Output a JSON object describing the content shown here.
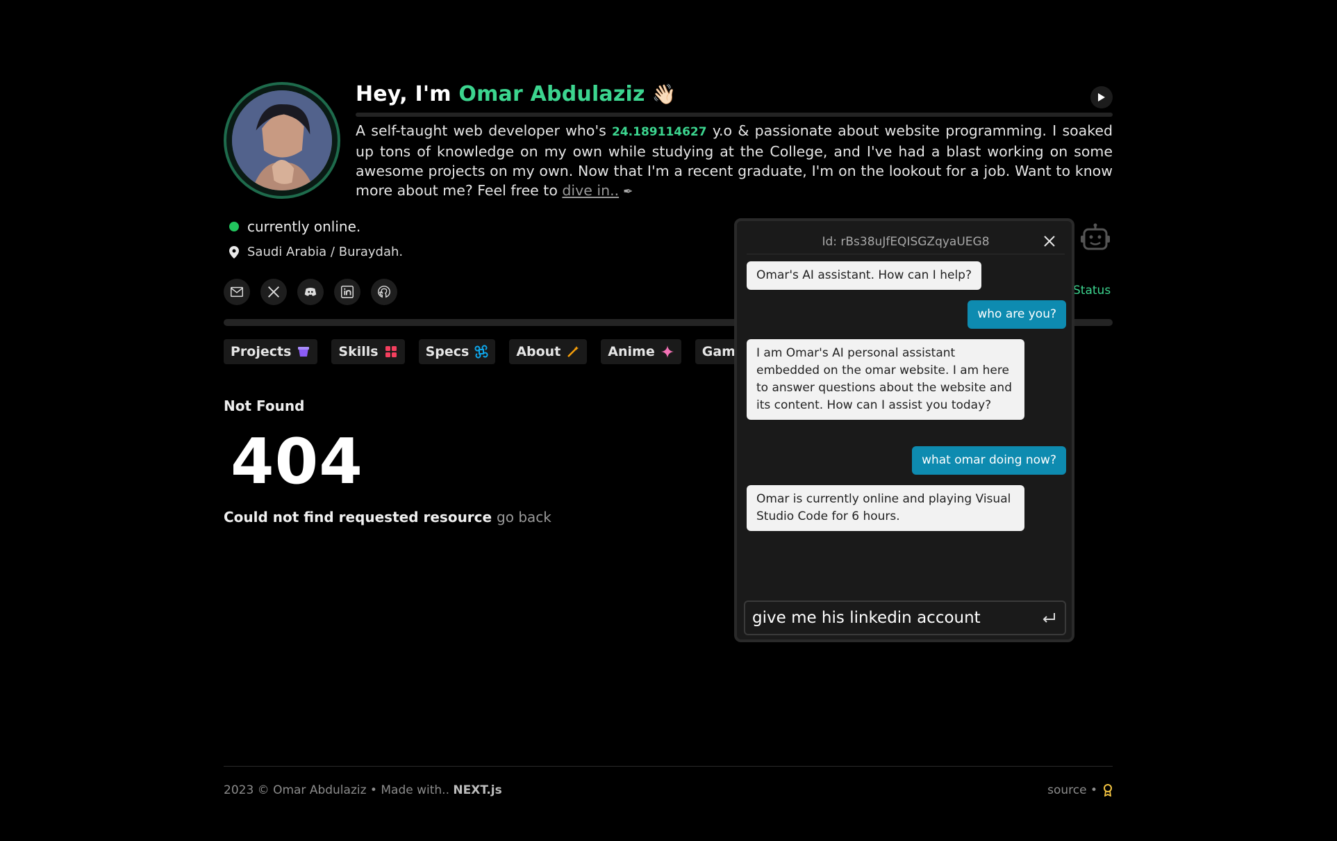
{
  "header": {
    "greeting": "Hey, I'm ",
    "name": "Omar Abdulaziz",
    "wave": "👋🏻"
  },
  "bio": {
    "part1": "A self-taught web developer who's ",
    "age": "24.189114627",
    "part2": " y.o & passionate about website programming. I soaked up tons of knowledge on my own while studying at the College, and I've had a blast working on some awesome projects on my own. Now that I'm a recent graduate, I'm on the lookout for a job. Want to know more about me? Feel free to ",
    "link": "dive in..",
    "pen": "✒"
  },
  "status": {
    "text": "currently online.",
    "location": "Saudi Arabia / Buraydah.",
    "link": "Status"
  },
  "socials": [
    "mail-icon",
    "x-icon",
    "discord-icon",
    "linkedin-icon",
    "github-icon"
  ],
  "tabs": [
    {
      "label": "Projects",
      "icon": "box-icon",
      "color": "#8b5cf6"
    },
    {
      "label": "Skills",
      "icon": "grid-icon",
      "color": "#f43f5e"
    },
    {
      "label": "Specs",
      "icon": "command-icon",
      "color": "#0ea5e9"
    },
    {
      "label": "About",
      "icon": "wand-icon",
      "color": "#f59e0b"
    },
    {
      "label": "Anime",
      "icon": "sparkle-icon",
      "color": "#f472b6"
    },
    {
      "label": "Games",
      "icon": "gamepad-icon",
      "color": "#a3a3a3"
    }
  ],
  "notfound": {
    "title": "Not Found",
    "code": "404",
    "message": "Could not find requested resource ",
    "back": "go back"
  },
  "footer": {
    "left": "2023 © Omar Abdulaziz • Made with.. ",
    "framework": "NEXT.js",
    "right": "source •"
  },
  "chat": {
    "id": "Id: rBs38uJfEQISGZqyaUEG8",
    "messages": [
      {
        "role": "bot",
        "text": "Omar's AI assistant. How can I help?"
      },
      {
        "role": "user",
        "text": "who are you?"
      },
      {
        "role": "bot",
        "text": "I am Omar's AI personal assistant embedded on the omar website. I am here to answer questions about the website and its content. How can I assist you today?"
      },
      {
        "role": "user",
        "text": "what omar doing now?"
      },
      {
        "role": "bot",
        "text": "Omar is currently online and playing Visual Studio Code for 6 hours."
      }
    ],
    "input_value": "give me his linkedin account"
  }
}
